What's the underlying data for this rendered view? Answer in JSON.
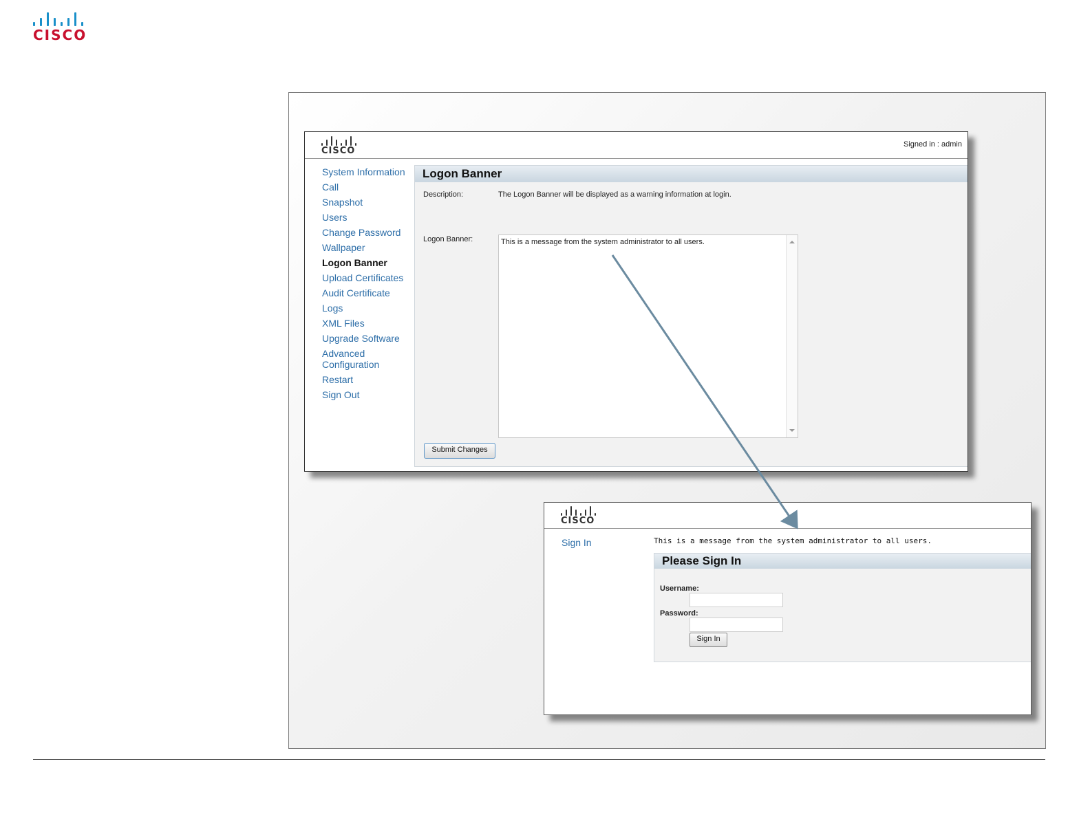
{
  "page": {
    "logo_text": "CISCO"
  },
  "admin": {
    "logo_text": "CISCO",
    "signed_in": "Signed in : admin",
    "nav": [
      "System Information",
      "Call",
      "Snapshot",
      "Users",
      "Change Password",
      "Wallpaper",
      "Logon Banner",
      "Upload Certificates",
      "Audit Certificate",
      "Logs",
      "XML Files",
      "Upgrade Software",
      "Advanced Configuration",
      "Restart",
      "Sign Out"
    ],
    "active_nav": "Logon Banner",
    "panel_title": "Logon Banner",
    "description_label": "Description:",
    "description_text": "The Logon Banner will be displayed as a warning information at login.",
    "banner_label": "Logon Banner:",
    "banner_value": "This is a message from the system administrator to all users.",
    "submit_label": "Submit Changes"
  },
  "signin": {
    "logo_text": "CISCO",
    "nav_label": "Sign In",
    "banner_message": "This is a message from the system administrator to all users.",
    "panel_title": "Please Sign In",
    "username_label": "Username:",
    "username_value": "",
    "password_label": "Password:",
    "password_value": "",
    "button_label": "Sign In"
  },
  "colors": {
    "cisco_blue": "#1a90c9",
    "cisco_red": "#c8102e",
    "link_blue": "#2d6ea8",
    "arrow": "#6b8ba0"
  }
}
